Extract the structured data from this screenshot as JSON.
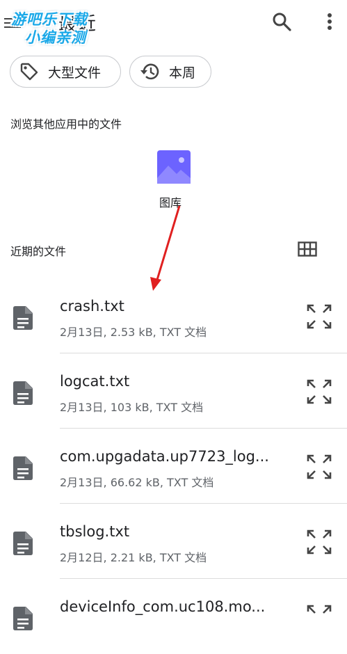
{
  "header": {
    "title": "最近",
    "watermark_line1": "游吧乐下载",
    "watermark_line2": "小编亲测"
  },
  "chips": {
    "large_files": "大型文件",
    "this_week": "本周"
  },
  "browse": {
    "label": "浏览其他应用中的文件",
    "apps": [
      {
        "label": "图库",
        "icon": "gallery-icon"
      }
    ]
  },
  "recent": {
    "label": "近期的文件",
    "files": [
      {
        "name": "crash.txt",
        "meta": "2月13日, 2.53 kB, TXT 文档"
      },
      {
        "name": "logcat.txt",
        "meta": "2月13日, 103 kB, TXT 文档"
      },
      {
        "name": "com.upgadata.up7723_log...",
        "meta": "2月13日, 66.62 kB, TXT 文档"
      },
      {
        "name": "tbslog.txt",
        "meta": "2月12日, 2.21 kB, TXT 文档"
      },
      {
        "name": "deviceInfo_com.uc108.mo...",
        "meta": ""
      }
    ]
  },
  "colors": {
    "accent_gallery": "#6c63ff",
    "annotation_arrow": "#e02020",
    "icon_gray": "#5f6368"
  }
}
